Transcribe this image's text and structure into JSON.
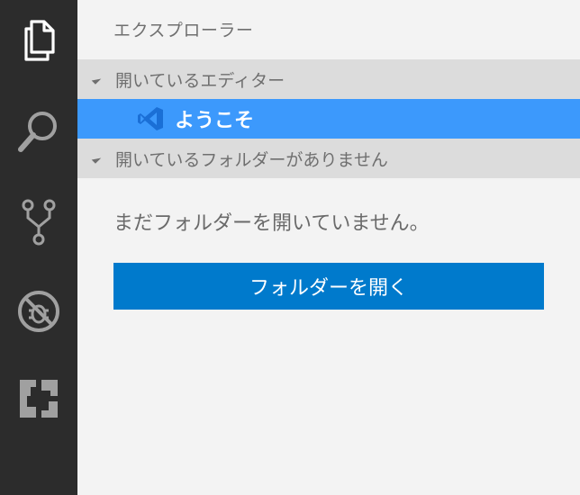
{
  "activity_bar": {
    "items": [
      {
        "name": "explorer",
        "icon": "files-icon"
      },
      {
        "name": "search",
        "icon": "search-icon"
      },
      {
        "name": "scm",
        "icon": "source-control-icon"
      },
      {
        "name": "debug",
        "icon": "debug-icon"
      },
      {
        "name": "extensions",
        "icon": "extensions-icon"
      }
    ],
    "background": "#2c2c2c",
    "icon_active_color": "#ffffff",
    "icon_inactive_color": "#a0a0a0"
  },
  "sidebar": {
    "title": "エクスプローラー",
    "open_editors": {
      "header": "開いているエディター",
      "items": [
        {
          "label": "ようこそ",
          "icon": "vscode-icon",
          "selected": true
        }
      ]
    },
    "no_folder": {
      "header": "開いているフォルダーがありません",
      "message": "まだフォルダーを開いていません。",
      "button_label": "フォルダーを開く"
    }
  },
  "colors": {
    "selection": "#3c99fc",
    "button": "#007acc",
    "section_header_bg": "#dcdcdc",
    "sidebar_bg": "#f3f3f3"
  }
}
